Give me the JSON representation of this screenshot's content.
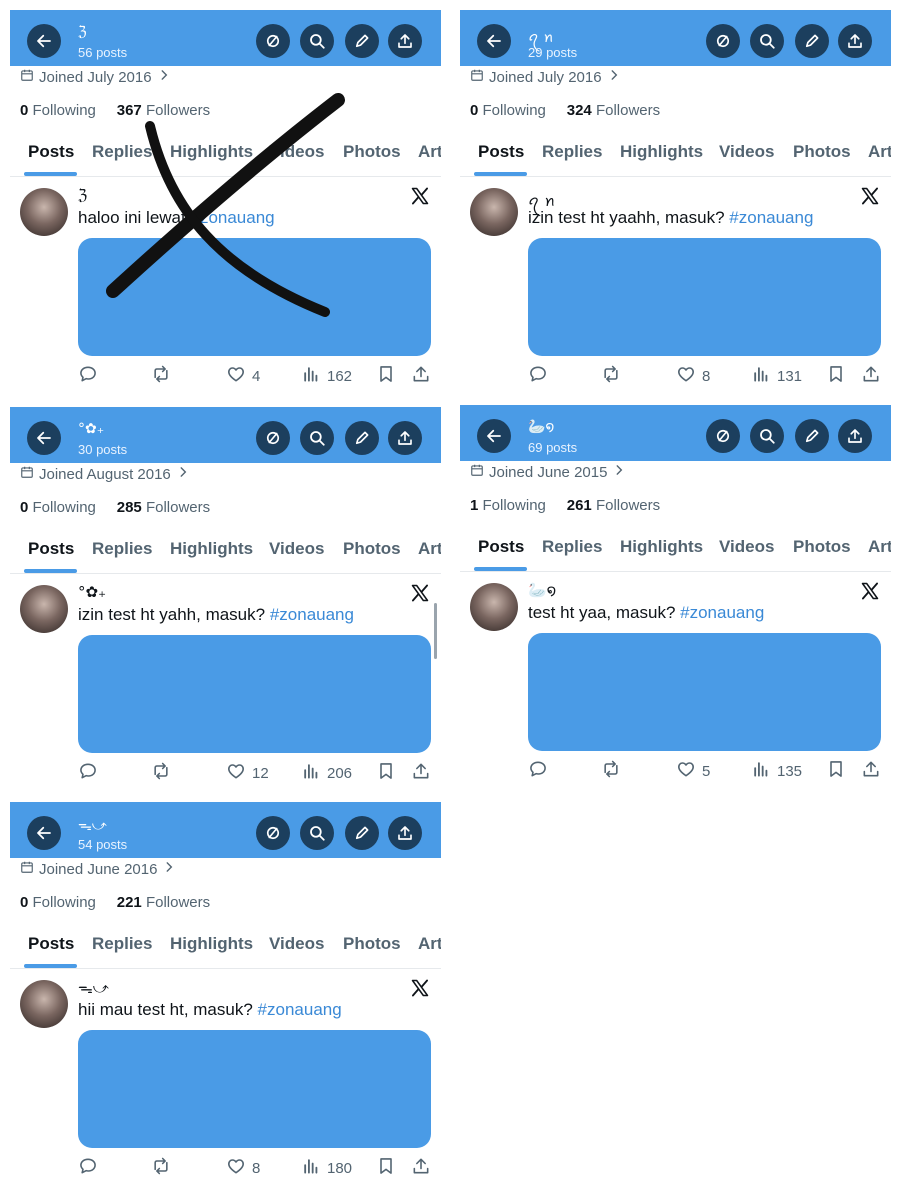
{
  "colors": {
    "header": "#4a9be6",
    "button": "#1c3f5e",
    "media": "#4a9be6",
    "hashtag": "#3a89d6",
    "muted": "#536471"
  },
  "icons": [
    "back-arrow-icon",
    "unfollow-icon",
    "search-icon",
    "edit-icon",
    "share-upload-icon",
    "calendar-icon",
    "chevron-right-icon",
    "x-logo-icon",
    "reply-icon",
    "retweet-icon",
    "like-icon",
    "views-icon",
    "bookmark-icon",
    "share-icon"
  ],
  "tabs": [
    "Posts",
    "Replies",
    "Highlights",
    "Videos",
    "Photos",
    "Art"
  ],
  "following_label": "Following",
  "followers_label": "Followers",
  "panels": [
    {
      "name": "ℨ",
      "posts_count": "56 posts",
      "joined": "Joined July 2016",
      "following": "0",
      "followers": "367",
      "post_text": "haloo ini lewat",
      "hashtag": "#zonauang",
      "stats": {
        "replies": "",
        "reposts": "",
        "likes": "4",
        "views": "162"
      },
      "crossed_out": true
    },
    {
      "name": "ꪖ ꪀ",
      "posts_count": "29 posts",
      "joined": "Joined July 2016",
      "following": "0",
      "followers": "324",
      "post_text": "izin test ht yaahh, masuk?",
      "hashtag": "#zonauang",
      "stats": {
        "replies": "",
        "reposts": "",
        "likes": "8",
        "views": "131"
      },
      "crossed_out": false
    },
    {
      "name": "°✿₊",
      "posts_count": "30 posts",
      "joined": "Joined August 2016",
      "following": "0",
      "followers": "285",
      "post_text": "izin test ht yahh, masuk?",
      "hashtag": "#zonauang",
      "stats": {
        "replies": "",
        "reposts": "",
        "likes": "12",
        "views": "206"
      },
      "crossed_out": false
    },
    {
      "name": "🦢໑",
      "posts_count": "69 posts",
      "joined": "Joined June 2015",
      "following": "1",
      "followers": "261",
      "post_text": "test ht yaa, masuk?",
      "hashtag": "#zonauang",
      "stats": {
        "replies": "",
        "reposts": "",
        "likes": "5",
        "views": "135"
      },
      "crossed_out": false
    },
    {
      "name": "ᯓ⤻",
      "posts_count": "54 posts",
      "joined": "Joined June 2016",
      "following": "0",
      "followers": "221",
      "post_text": "hii mau test ht, masuk?",
      "hashtag": "#zonauang",
      "stats": {
        "replies": "",
        "reposts": "",
        "likes": "8",
        "views": "180"
      },
      "crossed_out": false
    }
  ]
}
